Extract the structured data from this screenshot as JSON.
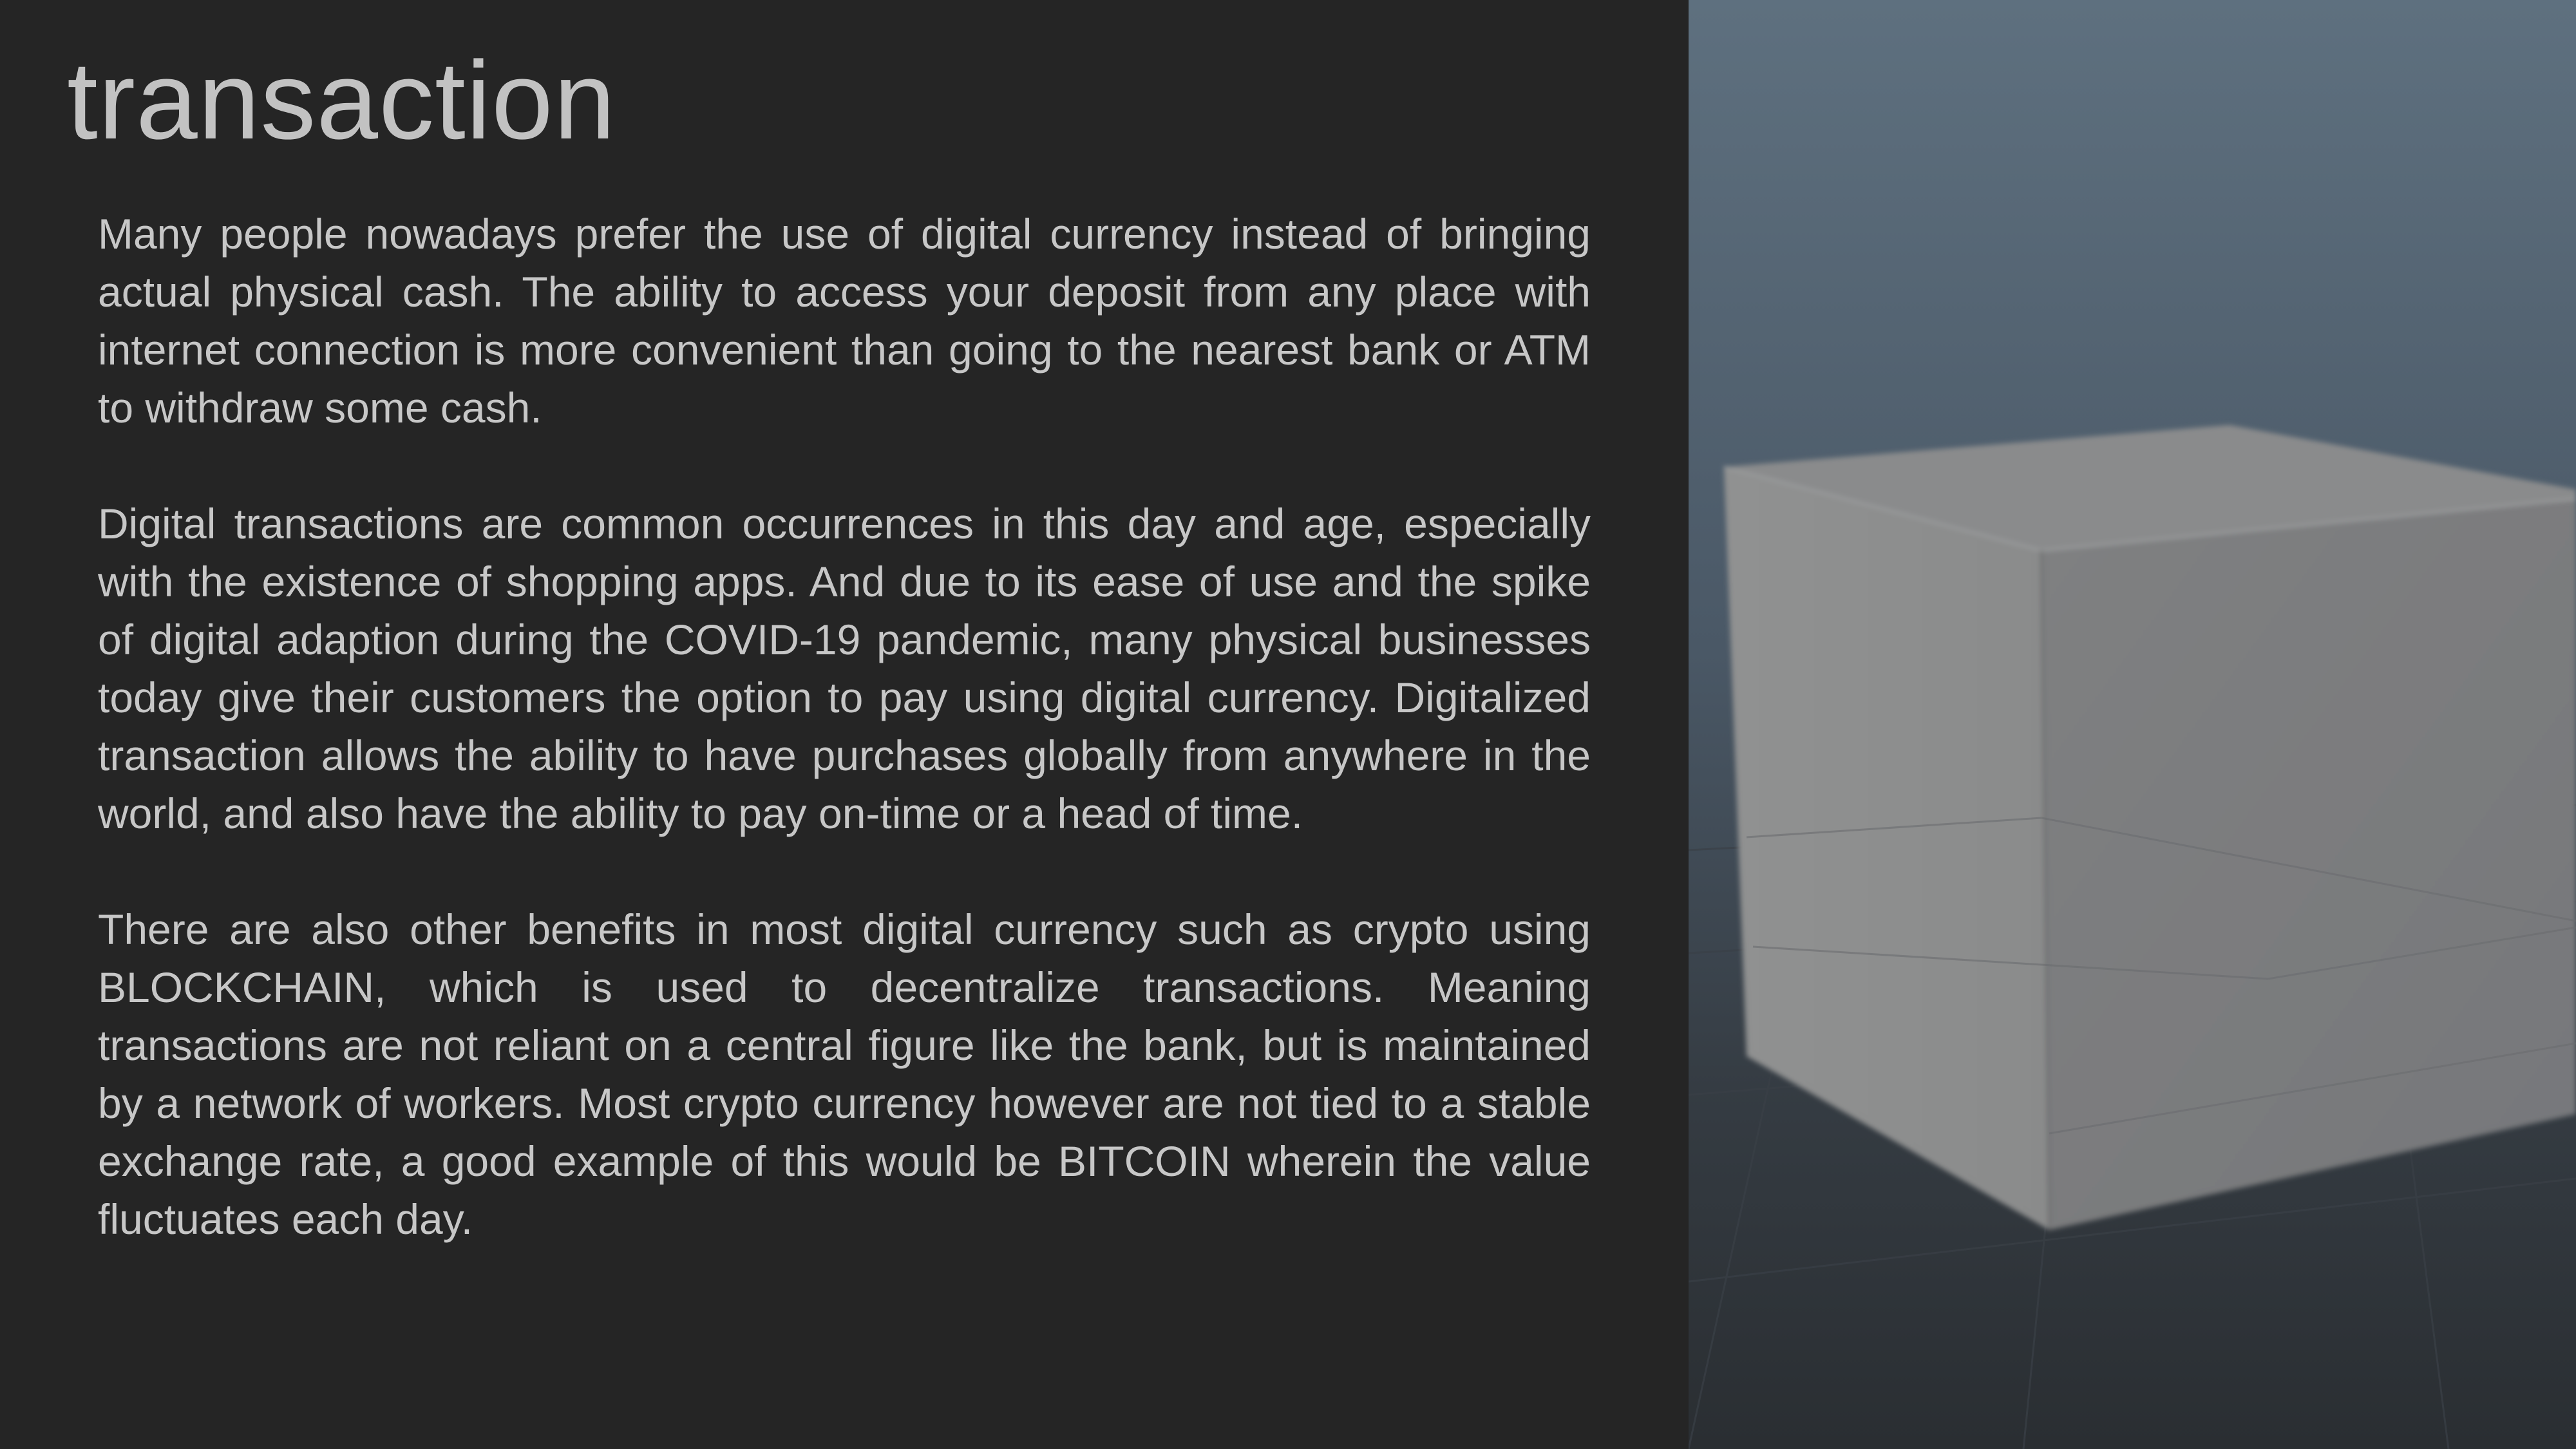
{
  "slide": {
    "title": "transaction",
    "paragraphs": [
      "Many people nowadays prefer the use of digital currency instead of bringing actual physical cash. The ability to access your deposit from any place with internet connection is more convenient than going to the nearest bank or ATM to withdraw some cash.",
      "Digital transactions are common occurrences in this day and age, especially with the existence of shopping apps. And due to its ease of use and the spike of digital adaption during the COVID-19 pandemic, many physical businesses today give their customers the option to pay using digital currency. Digitalized transaction allows the ability to have purchases globally from anywhere in the world, and also have the ability to pay on-time or a head of time.",
      "There are also other benefits in most digital currency such as crypto using BLOCKCHAIN, which is used to decentralize transactions. Meaning transactions are not reliant on a central figure like the bank, but is maintained by a network of workers. Most crypto currency however are not tied to a stable exchange rate, a good example of this would be BITCOIN wherein the value fluctuates each day."
    ]
  },
  "colors": {
    "background": "#252525",
    "title": "#c2c2c2",
    "body_text": "#c7c7c7",
    "scene_sky_top": "#5e707f",
    "scene_floor": "#2f3439",
    "cube_front": "#8e8f8f",
    "cube_side": "#7c7d7e",
    "cube_top": "#8a8b8c"
  },
  "scene": {
    "image": "3d-viewport-cube-image"
  }
}
